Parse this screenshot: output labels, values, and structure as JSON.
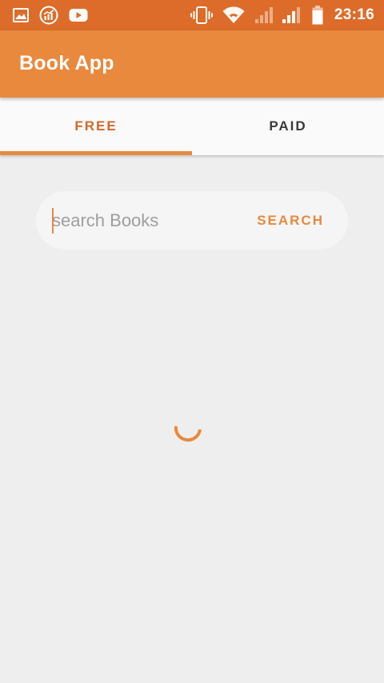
{
  "status_bar": {
    "time": "23:16",
    "left_icons": [
      "image-icon",
      "analytics-icon",
      "youtube-icon"
    ],
    "right_icons": [
      "vibrate-icon",
      "wifi-icon",
      "signal-weak-icon",
      "signal-icon",
      "battery-icon"
    ]
  },
  "app_bar": {
    "title": "Book App"
  },
  "tabs": [
    {
      "label": "FREE",
      "selected": true
    },
    {
      "label": "PAID",
      "selected": false
    }
  ],
  "search": {
    "placeholder": "search Books",
    "value": "",
    "button_label": "SEARCH"
  },
  "colors": {
    "status_bar": "#DD6C2A",
    "app_bar": "#E8893E",
    "accent": "#E8893E",
    "tab_selected_text": "#CE6A2A",
    "tab_unselected_text": "#3A3A3A",
    "background": "#EEEEEE"
  },
  "loading_indicator": "spinner"
}
